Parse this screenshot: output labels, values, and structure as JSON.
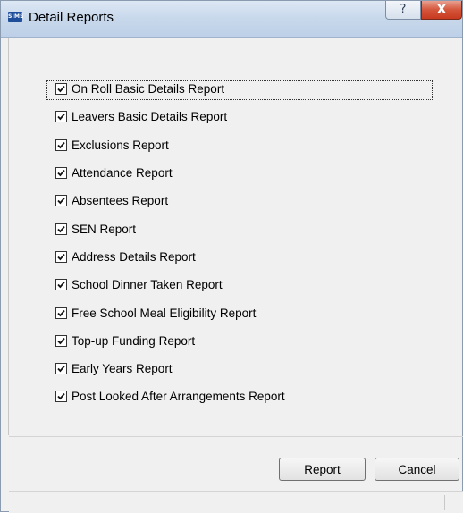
{
  "window": {
    "title": "Detail Reports",
    "app_icon_text": "SIMS",
    "help_glyph": "?",
    "close_glyph": "X"
  },
  "reports": [
    {
      "label": "On Roll Basic Details Report",
      "checked": true
    },
    {
      "label": "Leavers Basic Details Report",
      "checked": true
    },
    {
      "label": "Exclusions Report",
      "checked": true
    },
    {
      "label": "Attendance Report",
      "checked": true
    },
    {
      "label": "Absentees Report",
      "checked": true
    },
    {
      "label": "SEN Report",
      "checked": true
    },
    {
      "label": "Address Details Report",
      "checked": true
    },
    {
      "label": "School Dinner Taken Report",
      "checked": true
    },
    {
      "label": "Free School Meal Eligibility Report",
      "checked": true
    },
    {
      "label": "Top-up Funding Report",
      "checked": true
    },
    {
      "label": "Early Years Report",
      "checked": true
    },
    {
      "label": "Post Looked After Arrangements Report",
      "checked": true
    }
  ],
  "buttons": {
    "report_label": "Report",
    "cancel_label": "Cancel"
  }
}
